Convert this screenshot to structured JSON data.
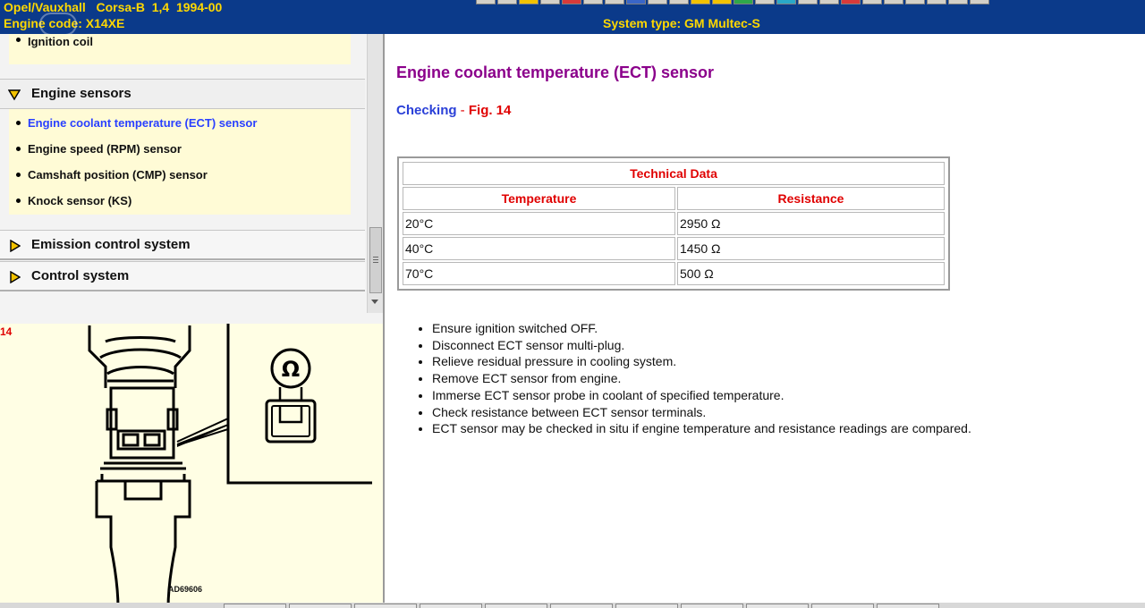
{
  "header": {
    "vehicle": "Opel/Vauxhall   Corsa-B  1,4  1994-00",
    "engine_code": "Engine code: X14XE",
    "system_type": "System type: GM Multec-S"
  },
  "nav": {
    "prev_items": [
      "Ignition coil"
    ],
    "open_section": "Engine sensors",
    "items": [
      "Engine coolant temperature (ECT) sensor",
      "Engine speed (RPM) sensor",
      "Camshaft position (CMP) sensor",
      "Knock sensor (KS)"
    ],
    "closed_sections": [
      "Emission control system",
      "Control system"
    ]
  },
  "figure": {
    "label": "14",
    "code": "AD69606",
    "ohm_symbol": "Ω"
  },
  "content": {
    "title": "Engine coolant temperature (ECT) sensor",
    "checking": "Checking",
    "separator": " - ",
    "fig_ref": "Fig. 14",
    "table": {
      "caption": "Technical Data",
      "headers": [
        "Temperature",
        "Resistance"
      ],
      "rows": [
        [
          "20°C",
          "2950 Ω"
        ],
        [
          "40°C",
          "1450 Ω"
        ],
        [
          "70°C",
          "500 Ω"
        ]
      ]
    },
    "steps": [
      "Ensure ignition switched OFF.",
      "Disconnect ECT sensor multi-plug.",
      "Relieve residual pressure in cooling system.",
      "Remove ECT sensor from engine.",
      "Immerse ECT sensor probe in coolant of specified temperature.",
      "Check resistance between ECT sensor terminals.",
      "ECT sensor may be checked in situ if engine temperature and resistance readings are compared."
    ]
  },
  "colors": {
    "header_bg": "#0b3a8a",
    "header_text": "#ffd800",
    "title": "#8b008b",
    "link_blue": "#2a40d8",
    "red": "#e00000",
    "list_bg": "#fffbd6"
  },
  "icons": {
    "section_open": "diamond-down-icon",
    "section_closed": "diamond-right-icon"
  }
}
